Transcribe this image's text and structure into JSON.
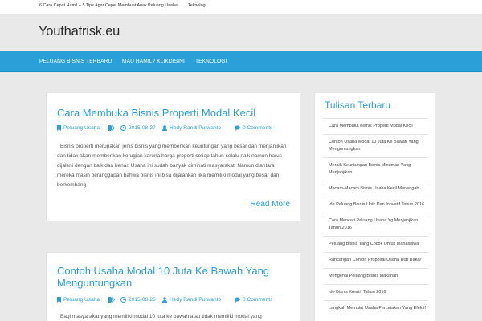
{
  "topbar": {
    "links": [
      "6 Cara Cepat Hamil + 5 Tips Agar Cepet Membuat Anak",
      "Peluang Usaha",
      "Teknologi"
    ]
  },
  "header": {
    "site_title": "Youthatrisk.eu"
  },
  "nav": {
    "items": [
      "PELUANG BISNIS TERBARU",
      "MAU HAMIL? KLIKDISINI",
      "TEKNOLOGI"
    ]
  },
  "posts": [
    {
      "title": "Cara Membuka Bisnis Properti Modal Kecil",
      "category": "Peluang Usaha",
      "date": "2015-08-27",
      "author": "Hedy Randi Purwanto",
      "comments": "0 Comments",
      "excerpt": "Bisnis properti merupakan jenis bisnis yang memberikan keuntungan yang besar dan menjanjikan dan tidak akan memberikan kerugian karena harga properti setiap tahun selalu naik namun harus dijaleni dengan baik dan benar. Usaha ini sudah banyak diminati masyarakat. Namun diantara mereka masih beranggapan bahwa bisnis ini bisa dijalankan jika memiliki modal yang besar dan berkembang",
      "read_more": "Read More"
    },
    {
      "title": "Contoh Usaha Modal 10 Juta Ke Bawah Yang Menguntungkan",
      "category": "Peluang Usaha",
      "date": "2015-08-26",
      "author": "Hedy Randi Purwanto",
      "comments": "0 Comments",
      "excerpt": "Bagi masyarakat yang memiliki modal 10 juta ke bawah atau tidak memiliki modal yang"
    }
  ],
  "sidebar": {
    "title": "Tulisan Terbaru",
    "items": [
      "Cara Membuka Bisnis Properti Modal Kecil",
      "Contoh Usaha Modal 10 Juta Ke Bawah Yang Menguntungkan",
      "Meraih Keuntungan Bisnis Minuman Yang Menjanjikan",
      "Macam-Macam Bisnis Usaha Kecil Menengah",
      "Ide Peluang Bisnis Unik Dan Inovatif Tahun 2016",
      "Cara Mencari Peluang Usaha Yg Menjanjikan Tahun 2016",
      "Peluang Bisnis Yang Cocok Untuk Mahasiswa",
      "Rancangan Contoh Proposal Usaha Roti Bakar",
      "Mengenal Peluang Bisnis Makanan",
      "Ide Bisnis Kreatif Tahun 2016",
      "Langkah Memulai Usaha Percetakan Yang Efektif"
    ]
  },
  "colors": {
    "accent": "#2a9fd8",
    "nav_bg": "#2a9fd8",
    "page_bg": "#e9e9e9"
  },
  "icons": {
    "category": "bookmark-icon",
    "tags": "tag-icon",
    "date": "clock-icon",
    "author": "user-icon",
    "comments": "comment-icon"
  }
}
